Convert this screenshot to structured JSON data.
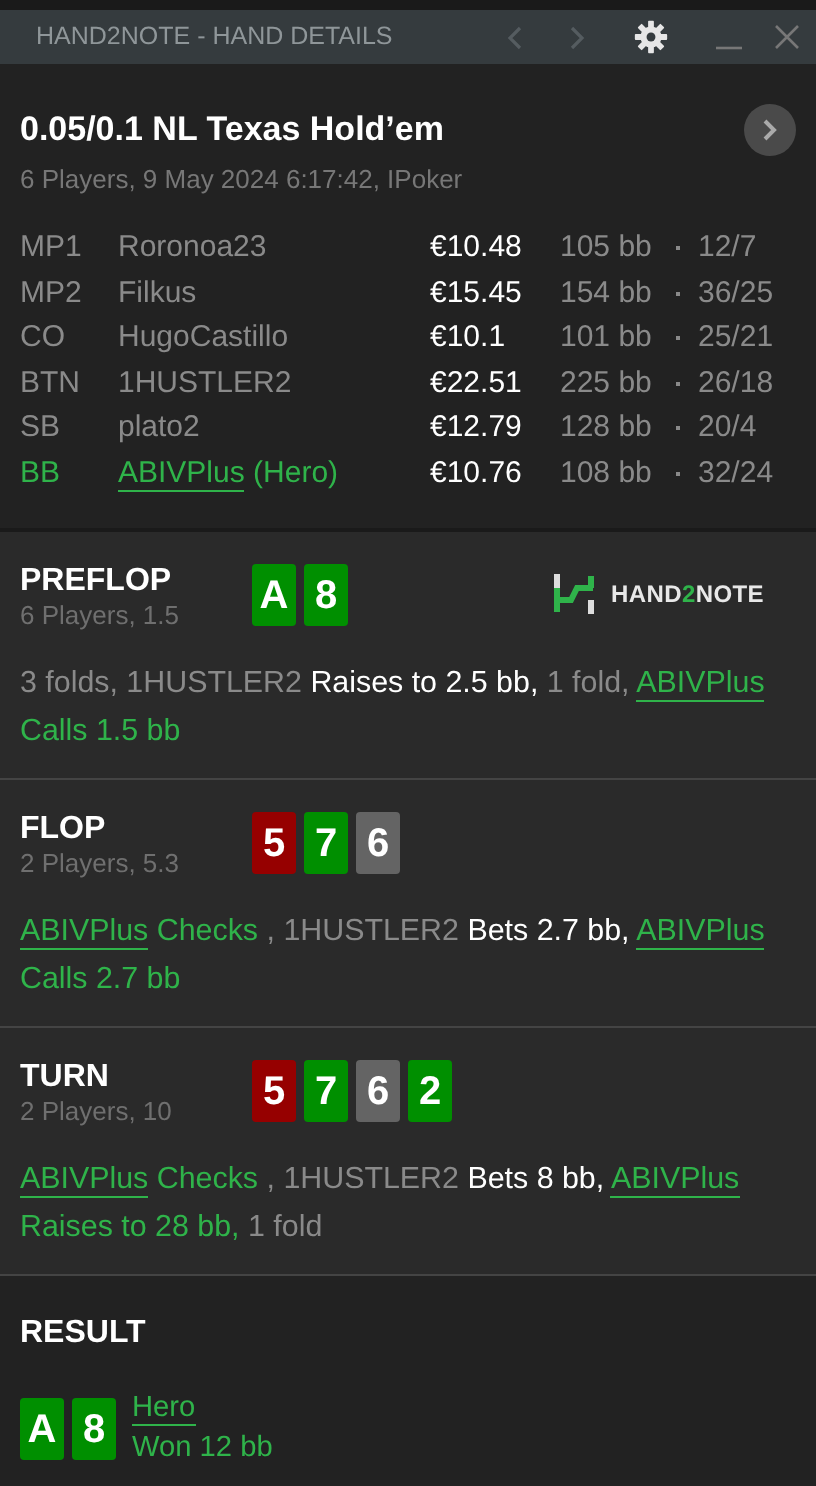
{
  "window": {
    "title": "HAND2NOTE - HAND DETAILS"
  },
  "hand": {
    "title": "0.05/0.1 NL Texas Hold’em",
    "subtitle": "6 Players, 9 May 2024 6:17:42, IPoker"
  },
  "players": [
    {
      "position": "MP1",
      "name": "Roronoa23",
      "stack": "€10.48",
      "bb": "105 bb",
      "stats": "12/7",
      "hero": false
    },
    {
      "position": "MP2",
      "name": "Filkus",
      "stack": "€15.45",
      "bb": "154 bb",
      "stats": "36/25",
      "hero": false
    },
    {
      "position": "CO",
      "name": "HugoCastillo",
      "stack": "€10.1",
      "bb": "101 bb",
      "stats": "25/21",
      "hero": false
    },
    {
      "position": "BTN",
      "name": "1HUSTLER2",
      "stack": "€22.51",
      "bb": "225 bb",
      "stats": "26/18",
      "hero": false
    },
    {
      "position": "SB",
      "name": "plato2",
      "stack": "€12.79",
      "bb": "128 bb",
      "stats": "20/4",
      "hero": false
    },
    {
      "position": "BB",
      "name": "ABIVPlus",
      "hero_label": "(Hero)",
      "stack": "€10.76",
      "bb": "108 bb",
      "stats": "32/24",
      "hero": true
    }
  ],
  "logo": [
    {
      "text": "HAND",
      "accent": false
    },
    {
      "text": "2",
      "accent": true
    },
    {
      "text": "NOTE",
      "accent": false
    }
  ],
  "streets": [
    {
      "name": "PREFLOP",
      "info": "6 Players, 1.5",
      "cards": [
        {
          "rank": "A",
          "color": "#008f00"
        },
        {
          "rank": "8",
          "color": "#008f00"
        }
      ],
      "actions": [
        {
          "kind": "muted",
          "text": "3 folds, 1HUSTLER2 "
        },
        {
          "kind": "bet",
          "text": "Raises to 2.5 bb, "
        },
        {
          "kind": "muted",
          "text": "1 fold, "
        },
        {
          "kind": "hero",
          "text": "ABIVPlus"
        },
        {
          "kind": "green",
          "text": " Calls 1.5 bb"
        }
      ]
    },
    {
      "name": "FLOP",
      "info": "2 Players, 5.3",
      "cards": [
        {
          "rank": "5",
          "color": "#960000"
        },
        {
          "rank": "7",
          "color": "#008f00"
        },
        {
          "rank": "6",
          "color": "#646464"
        }
      ],
      "actions": [
        {
          "kind": "hero",
          "text": "ABIVPlus"
        },
        {
          "kind": "green",
          "text": " Checks "
        },
        {
          "kind": "muted",
          "text": ", 1HUSTLER2 "
        },
        {
          "kind": "bet",
          "text": "Bets 2.7 bb, "
        },
        {
          "kind": "hero",
          "text": "ABIVPlus"
        },
        {
          "kind": "green",
          "text": " Calls 2.7 bb"
        }
      ]
    },
    {
      "name": "TURN",
      "info": "2 Players, 10",
      "cards": [
        {
          "rank": "5",
          "color": "#960000"
        },
        {
          "rank": "7",
          "color": "#008f00"
        },
        {
          "rank": "6",
          "color": "#646464"
        },
        {
          "rank": "2",
          "color": "#008f00"
        }
      ],
      "actions": [
        {
          "kind": "hero",
          "text": "ABIVPlus"
        },
        {
          "kind": "green",
          "text": " Checks "
        },
        {
          "kind": "muted",
          "text": ", 1HUSTLER2 "
        },
        {
          "kind": "bet",
          "text": "Bets 8 bb, "
        },
        {
          "kind": "hero",
          "text": "ABIVPlus"
        },
        {
          "kind": "green",
          "text": " Raises to 28 bb, "
        },
        {
          "kind": "muted",
          "text": "1 fold"
        }
      ]
    }
  ],
  "result": {
    "title": "RESULT",
    "cards": [
      {
        "rank": "A",
        "color": "#008f00"
      },
      {
        "rank": "8",
        "color": "#008f00"
      }
    ],
    "player": "Hero",
    "amount": "Won 12 bb"
  }
}
